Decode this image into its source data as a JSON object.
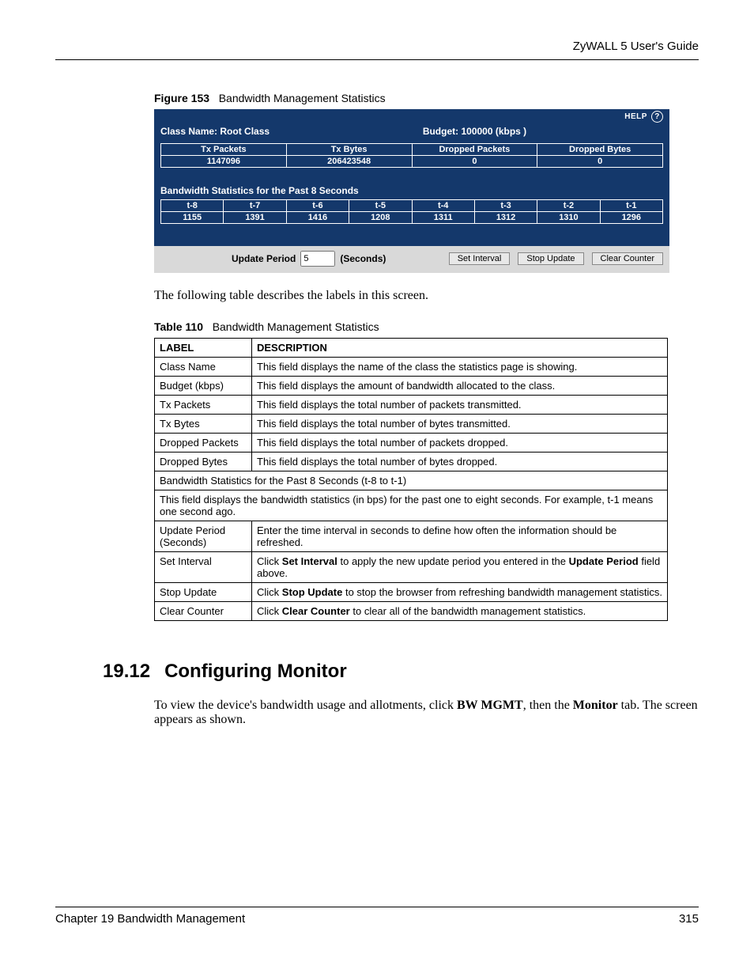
{
  "header": {
    "right": "ZyWALL 5 User's Guide"
  },
  "figure": {
    "num": "Figure 153",
    "title": "Bandwidth Management Statistics"
  },
  "ui": {
    "help_label": "HELP",
    "class_line": {
      "left": "Class Name: Root Class",
      "right": "Budget: 100000 (kbps )"
    },
    "summary_headers": [
      "Tx Packets",
      "Tx Bytes",
      "Dropped Packets",
      "Dropped Bytes"
    ],
    "summary_values": [
      "1147096",
      "206423548",
      "0",
      "0"
    ],
    "past8_title": "Bandwidth Statistics for the Past 8 Seconds",
    "past8_headers": [
      "t-8",
      "t-7",
      "t-6",
      "t-5",
      "t-4",
      "t-3",
      "t-2",
      "t-1"
    ],
    "past8_values": [
      "1155",
      "1391",
      "1416",
      "1208",
      "1311",
      "1312",
      "1310",
      "1296"
    ],
    "controls": {
      "period_label": "Update Period",
      "period_value": "5",
      "period_unit": "(Seconds)",
      "set_interval": "Set Interval",
      "stop_update": "Stop Update",
      "clear_counter": "Clear Counter"
    }
  },
  "intro": "The following table describes the labels in this screen.",
  "table": {
    "num": "Table 110",
    "title": "Bandwidth Management Statistics",
    "head": [
      "LABEL",
      "DESCRIPTION"
    ],
    "rows": [
      {
        "label": "Class Name",
        "desc": "This field displays the name of the class the statistics page is showing."
      },
      {
        "label": "Budget (kbps)",
        "desc": "This field displays the amount of bandwidth allocated to the class."
      },
      {
        "label": "Tx Packets",
        "desc": "This field displays the total number of packets transmitted."
      },
      {
        "label": "Tx Bytes",
        "desc": "This field displays the total number of bytes transmitted."
      },
      {
        "label": "Dropped Packets",
        "desc": "This field displays the total number of packets dropped."
      },
      {
        "label": "Dropped Bytes",
        "desc": "This field displays the total number of bytes dropped."
      }
    ],
    "span1": "Bandwidth Statistics for the Past 8 Seconds (t-8 to t-1)",
    "span2": "This field displays the bandwidth statistics (in bps) for the past one to eight seconds. For example, t-1 means one second ago.",
    "rows2": [
      {
        "label": "Update Period (Seconds)",
        "desc": "Enter the time interval in seconds to define how often the information should be refreshed."
      }
    ],
    "set_interval": {
      "label": "Set Interval",
      "pre": "Click ",
      "b1": "Set Interval",
      "mid": " to apply the new update period you entered in the ",
      "b2": "Update Period",
      "post": " field above."
    },
    "stop_update": {
      "label": "Stop Update",
      "pre": "Click ",
      "b1": "Stop Update",
      "post": " to stop the browser from refreshing bandwidth management statistics."
    },
    "clear_counter": {
      "label": "Clear Counter",
      "pre": "Click ",
      "b1": "Clear Counter",
      "post": " to clear all of the bandwidth management statistics."
    }
  },
  "section": {
    "num": "19.12",
    "title": "Configuring Monitor",
    "para_pre": "To view the device's bandwidth usage and allotments, click ",
    "para_b1": "BW MGMT",
    "para_mid": ", then the ",
    "para_b2": "Monitor",
    "para_post": " tab. The screen appears as shown."
  },
  "footer": {
    "left": "Chapter 19 Bandwidth Management",
    "right": "315"
  }
}
